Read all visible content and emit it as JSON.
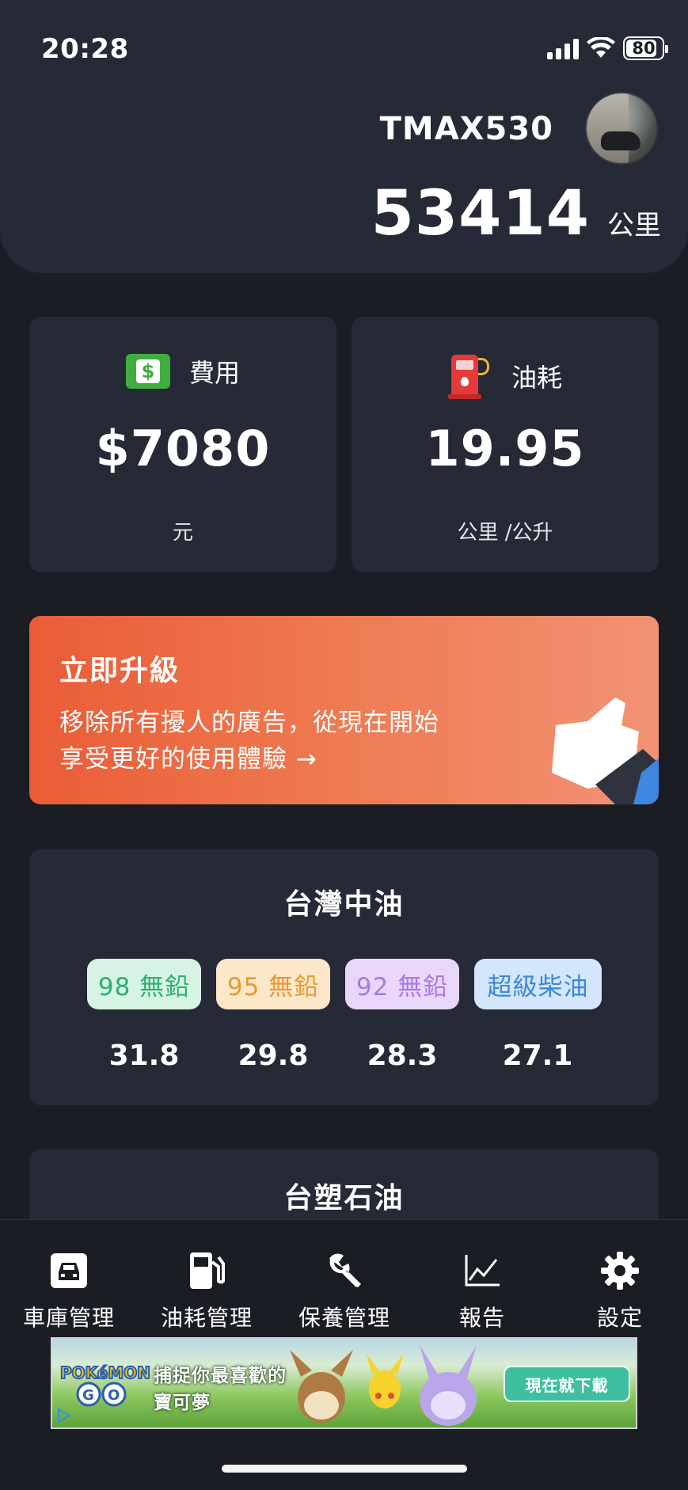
{
  "status_bar": {
    "time": "20:28",
    "battery": "80"
  },
  "vehicle": {
    "name": "TMAX530",
    "mileage": "53414",
    "mileage_unit": "公里"
  },
  "stats": {
    "cost": {
      "label": "費用",
      "value": "$7080",
      "unit": "元",
      "icon": "money-icon"
    },
    "fuel": {
      "label": "油耗",
      "value": "19.95",
      "unit": "公里 /公升",
      "icon": "fuel-pump-icon"
    }
  },
  "upgrade": {
    "title": "立即升級",
    "line1": "移除所有擾人的廣告，從現在開始",
    "line2": "享受更好的使用體驗 →"
  },
  "gas_prices": [
    {
      "company": "台灣中油",
      "fuels": [
        {
          "name": "98 無鉛",
          "price": "31.8",
          "color": "#2fae72",
          "bg": "#d7f3e3"
        },
        {
          "name": "95 無鉛",
          "price": "29.8",
          "color": "#e79a33",
          "bg": "#fde7c9"
        },
        {
          "name": "92 無鉛",
          "price": "28.3",
          "color": "#a97ae0",
          "bg": "#e9d7fb"
        },
        {
          "name": "超級柴油",
          "price": "27.1",
          "color": "#3d86d8",
          "bg": "#d3e6fb"
        }
      ]
    },
    {
      "company": "台塑石油"
    }
  ],
  "nav": [
    {
      "label": "車庫管理",
      "icon": "car-icon"
    },
    {
      "label": "油耗管理",
      "icon": "gas-station-icon"
    },
    {
      "label": "保養管理",
      "icon": "wrench-icon"
    },
    {
      "label": "報告",
      "icon": "chart-icon"
    },
    {
      "label": "設定",
      "icon": "gear-icon"
    }
  ],
  "ad": {
    "brand": "POKéMON GO",
    "headline_line1": "捕捉你最喜歡的",
    "headline_line2": "寶可夢",
    "cta": "現在就下載"
  },
  "colors": {
    "background": "#1b1d24",
    "card": "#262936",
    "accent": "#ea5c37"
  }
}
